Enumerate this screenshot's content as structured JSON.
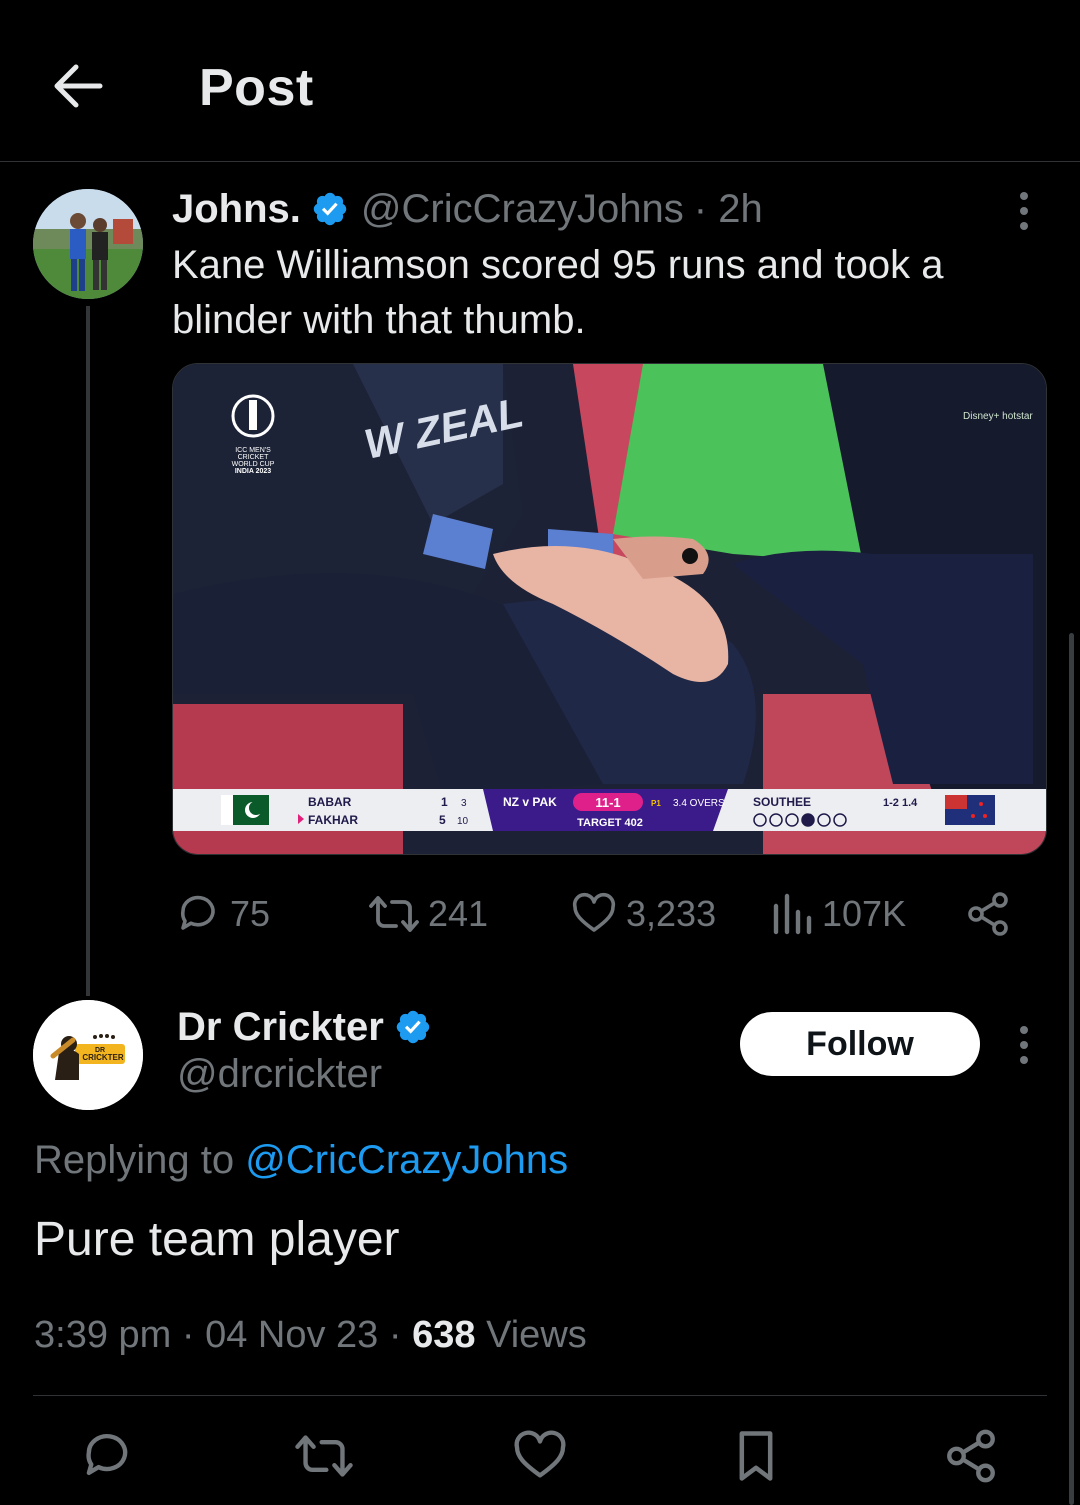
{
  "header": {
    "title": "Post"
  },
  "tweet": {
    "author_name": "Johns.",
    "author_handle": "@CricCrazyJohns",
    "time": "· 2h",
    "text": "Kane Williamson scored 95 runs and took a blinder with that thumb.",
    "media": {
      "tournament_logo": "ICC MEN'S CRICKET WORLD CUP INDIA 2023",
      "jersey_text": "W ZEAL",
      "broadcaster": "Disney+ hotstar",
      "score": {
        "batter1": "BABAR",
        "batter1_runs": "1",
        "batter1_balls": "3",
        "batter2": "FAKHAR",
        "batter2_runs": "5",
        "batter2_balls": "10",
        "matchup": "NZ v PAK",
        "score": "11-1",
        "powerplay": "P1",
        "overs": "3.4 OVERS",
        "target": "TARGET 402",
        "bowler": "SOUTHEE",
        "bowler_figures": "1-2 1.4"
      }
    },
    "stats": {
      "replies": "75",
      "reposts": "241",
      "likes": "3,233",
      "views": "107K"
    }
  },
  "reply": {
    "author_name": "Dr Crickter",
    "author_handle": "@drcrickter",
    "follow_label": "Follow",
    "replying_prefix": "Replying to ",
    "replying_to": "@CricCrazyJohns",
    "text": "Pure team player",
    "time": "3:39 pm",
    "date": "04 Nov 23",
    "views_count": "638",
    "views_label": "Views",
    "avatar_text": "DR CRICKTER"
  },
  "colors": {
    "accent": "#1d9bf0",
    "muted": "#71767b",
    "text": "#e7e9ea",
    "background": "#000000"
  },
  "icons": [
    "back-arrow-icon",
    "verified-badge-icon",
    "more-icon",
    "reply-icon",
    "repost-icon",
    "like-icon",
    "views-icon",
    "share-icon",
    "bookmark-icon"
  ]
}
